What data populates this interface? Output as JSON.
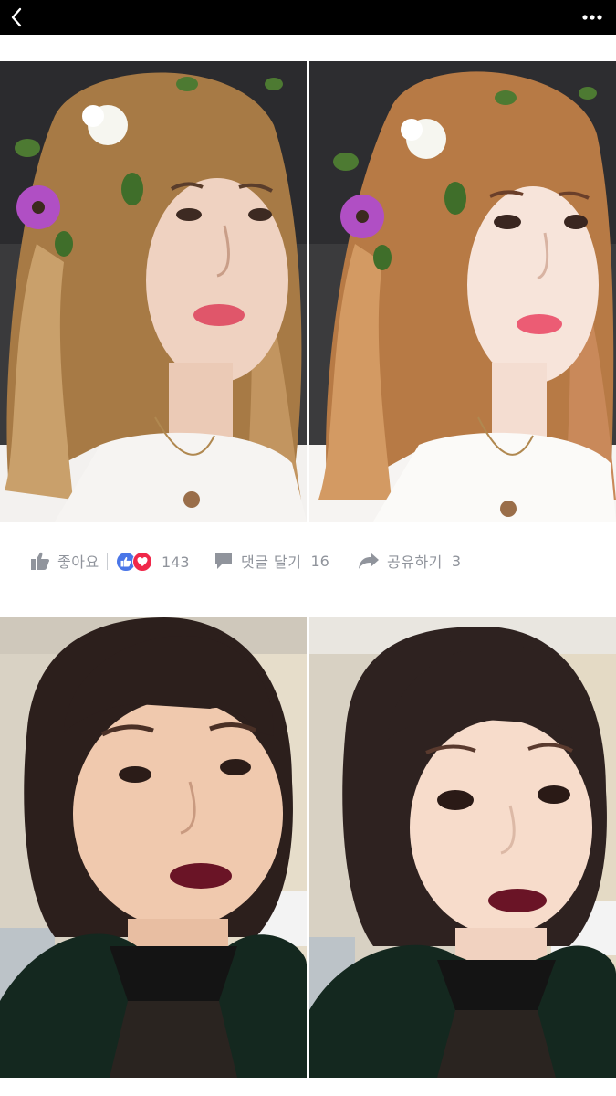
{
  "header": {
    "back_icon": "chevron-left-icon",
    "more_icon": "more-dots-icon"
  },
  "actions": {
    "like_label": "좋아요",
    "reaction_count": "143",
    "comment_label": "댓글 달기",
    "comment_count": "16",
    "share_label": "공유하기",
    "share_count": "3"
  },
  "colors": {
    "topbar": "#000000",
    "action_text": "#90949c",
    "like_blue": "#4a76e8",
    "love_red": "#f0284a"
  }
}
